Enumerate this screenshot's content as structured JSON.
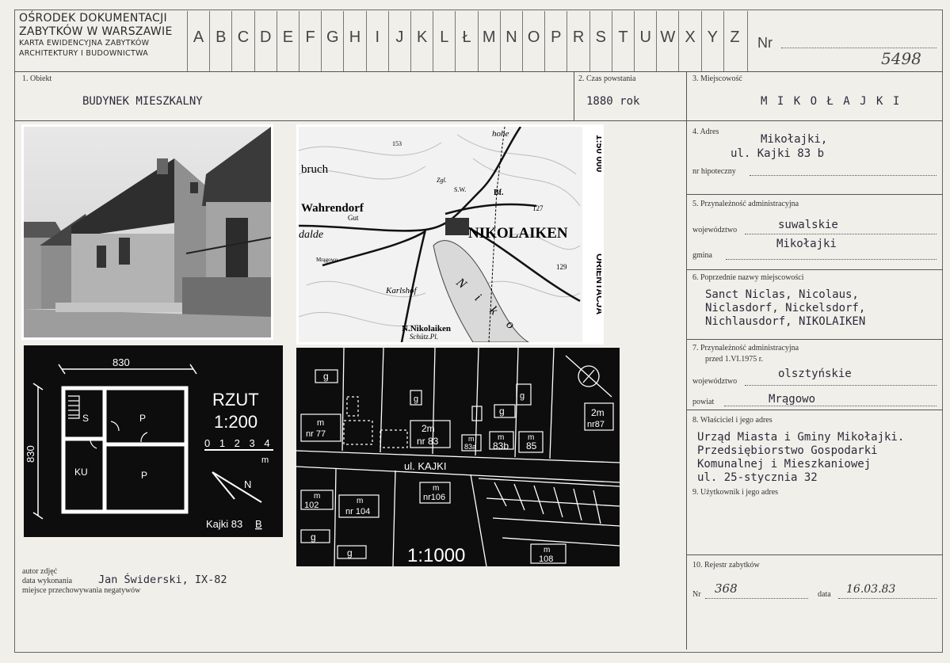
{
  "header": {
    "org_line1": "OŚRODEK DOKUMENTACJI",
    "org_line2": "ZABYTKÓW W WARSZAWIE",
    "org_line3": "KARTA EWIDENCYJNA ZABYTKÓW",
    "org_line4": "ARCHITEKTURY I BUDOWNICTWA",
    "letters": [
      "A",
      "B",
      "C",
      "D",
      "E",
      "F",
      "G",
      "H",
      "I",
      "J",
      "K",
      "L",
      "Ł",
      "M",
      "N",
      "O",
      "P",
      "R",
      "S",
      "T",
      "U",
      "W",
      "X",
      "Y",
      "Z"
    ],
    "nr_label": "Nr",
    "nr_value": "5498"
  },
  "fields": {
    "obiekt_label": "1. Obiekt",
    "obiekt_value": "BUDYNEK MIESZKALNY",
    "czas_label": "2. Czas powstania",
    "czas_value": "1880 rok",
    "miejscowosc_label": "3. Miejscowość",
    "miejscowosc_value": "M I K O Ł A J K I",
    "adres_label": "4. Adres",
    "adres_line1": "Mikołajki,",
    "adres_line2": "ul. Kajki 83 b",
    "hipoteczny_label": "nr hipoteczny",
    "admin_label": "5. Przynależność administracyjna",
    "wojewodztwo_label": "województwo",
    "wojewodztwo_value": "suwalskie",
    "gmina_label": "gmina",
    "gmina_value": "Mikołajki",
    "poprzednie_label": "6. Poprzednie nazwy miejscowości",
    "poprzednie_line1": "Sanct Niclas, Nicolaus,",
    "poprzednie_line2": "Niclasdorf, Nickelsdorf,",
    "poprzednie_line3": "Nichlausdorf, NIKOLAIKEN",
    "admin_old_label": "7. Przynależność administracyjna",
    "admin_old_sub": "przed 1.VI.1975 r.",
    "woj_old_label": "województwo",
    "woj_old_value": "olsztyńskie",
    "powiat_label": "powiat",
    "powiat_value": "Mrągowo",
    "wlasciciel_label": "8. Właściciel i jego adres",
    "wlasciciel_line1": "Urząd Miasta i Gminy Mikołajki.",
    "wlasciciel_line2": "Przedsiębiorstwo Gospodarki",
    "wlasciciel_line3": "Komunalnej i Mieszkaniowej",
    "wlasciciel_line4": "ul. 25-stycznia 32",
    "uzytkownik_label": "9. Użytkownik i jego adres",
    "rejestr_label": "10. Rejestr zabytków",
    "rejestr_nr_label": "Nr",
    "rejestr_nr_value": "368",
    "rejestr_data_label": "data",
    "rejestr_data_value": "16.03.83"
  },
  "photo_credits": {
    "autor_label": "autor zdjęć",
    "data_label": "data wykonania",
    "data_value": "Jan Świderski, IX-82",
    "miejsce_label": "miejsce przechowywania negatywów"
  },
  "map": {
    "scale": "1:50 000",
    "orientacja": "ORIENTACJA",
    "town": "NIKOLAIKEN",
    "label_wahrendorf": "Wahrendorf",
    "label_gut": "Gut",
    "label_bruch": "bruch",
    "label_dalde": "dalde",
    "label_karlshof": "Karlshof",
    "label_nikolaiken2": "N.Nikolaiken",
    "label_schuetz": "Schütz.Pl.",
    "label_hohe": "hohe",
    "label_bf": "Bf.",
    "label_sw": "S.W.",
    "label_zgl": "Zgl.",
    "label_mragowo": "Mrągowo",
    "label_129": "129",
    "label_127": "127",
    "label_153": "153",
    "label_niko": "N i k o"
  },
  "plan": {
    "dim_top": "830",
    "dim_left": "830",
    "rzut": "RZUT",
    "scale": "1:200",
    "scale_ticks": "0 1 2 3 4",
    "scale_unit": "m",
    "room_s": "S",
    "room_p1": "P",
    "room_ku": "KU",
    "room_p2": "P",
    "caption": "Kajki 83",
    "caption_b": "B",
    "north": "N"
  },
  "site": {
    "scale": "1:1000",
    "street": "ul. KAJKI",
    "b_g1": "g",
    "b_m77": "m",
    "b_nr77": "nr 77",
    "b_g2": "g",
    "b_2m83": "2m",
    "b_nr83": "nr 83",
    "b_m83a": "m",
    "b_83a": "83a",
    "b_m83b": "m",
    "b_83b": "83b",
    "b_m85": "m",
    "b_85": "85",
    "b_g3": "g",
    "b_g4": "g",
    "b_2m87": "2m",
    "b_nr87": "nr87",
    "b_m102": "m",
    "b_102": "102",
    "b_m104": "m",
    "b_nr104": "nr 104",
    "b_m106": "m",
    "b_nr106": "nr106",
    "b_g5": "g",
    "b_g6": "g",
    "b_m108": "m",
    "b_108": "108"
  }
}
